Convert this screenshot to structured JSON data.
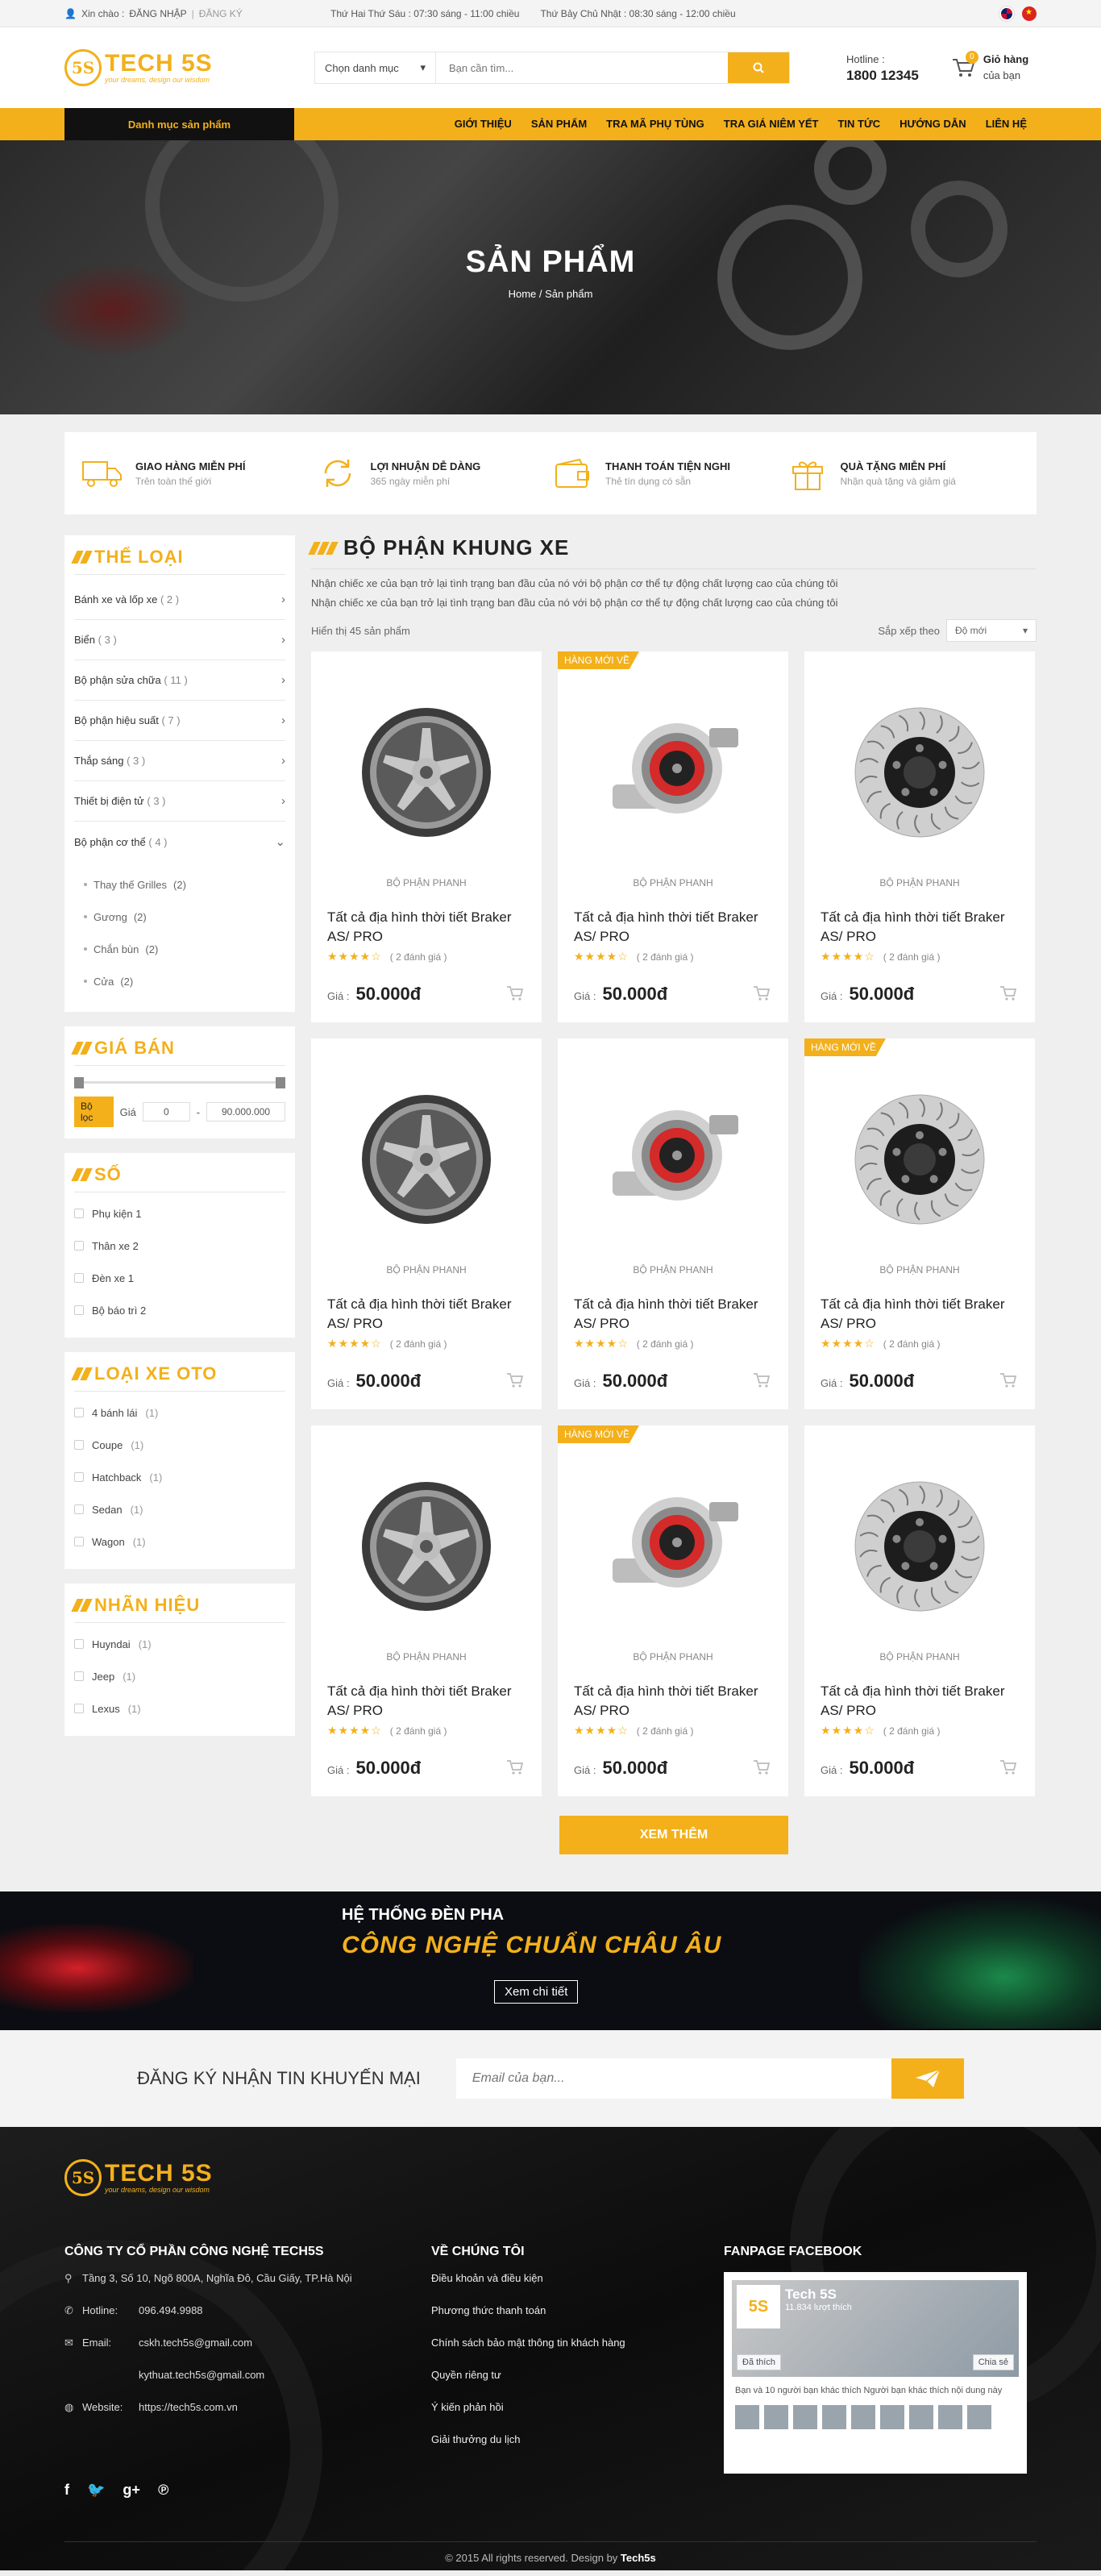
{
  "topbar": {
    "greeting": "Xin chào :",
    "login": "ĐĂNG NHẬP",
    "separator": "|",
    "register": "ĐĂNG KÝ",
    "hours_weekday": "Thứ Hai Thứ Sáu : 07:30 sáng - 11:00 chiều",
    "hours_weekend": "Thứ Bảy Chủ Nhật : 08:30 sáng - 12:00 chiều"
  },
  "header": {
    "logo_text": "TECH 5S",
    "logo_mark": "5S",
    "logo_slogan": "your dreams, design our wisdom",
    "search_category": "Chọn danh mục",
    "search_placeholder": "Bạn cần tìm...",
    "hotline_label": "Hotline :",
    "hotline_number": "1800 12345",
    "cart_count": "0",
    "cart_title": "Giỏ hàng",
    "cart_sub": "của bạn"
  },
  "nav": {
    "categories_label": "Danh mục sản phẩm",
    "items": [
      "GIỚI THIỆU",
      "SẢN PHẨM",
      "TRA MÃ PHỤ TÙNG",
      "TRA GIÁ NIÊM YẾT",
      "TIN TỨC",
      "HƯỚNG DẪN",
      "LIÊN HỆ"
    ]
  },
  "hero": {
    "title": "SẢN PHẨM",
    "breadcrumb_home": "Home",
    "breadcrumb_sep": "/",
    "breadcrumb_current": "Sản phẩm"
  },
  "features": [
    {
      "title": "GIAO HÀNG MIỄN PHÍ",
      "sub": "Trên toàn thế giới",
      "icon": "truck-icon"
    },
    {
      "title": "LỢI NHUẬN DỄ DÀNG",
      "sub": "365 ngày miễn phí",
      "icon": "refresh-icon"
    },
    {
      "title": "THANH TOÁN TIỆN NGHI",
      "sub": "Thẻ tín dụng có sẵn",
      "icon": "wallet-icon"
    },
    {
      "title": "QUÀ TẶNG MIỄN PHÍ",
      "sub": "Nhận quà tặng và giảm giá",
      "icon": "gift-icon"
    }
  ],
  "sidebar": {
    "category_title": "THỂ LOẠI",
    "categories": [
      {
        "label": "Bánh xe và lốp xe",
        "count": "( 2 )"
      },
      {
        "label": "Biển",
        "count": "( 3 )"
      },
      {
        "label": "Bộ phận sửa chữa",
        "count": "( 11 )"
      },
      {
        "label": "Bộ phận hiệu suất",
        "count": "( 7 )"
      },
      {
        "label": "Thắp sáng",
        "count": "( 3 )"
      },
      {
        "label": "Thiết bị điện tử",
        "count": "( 3 )"
      },
      {
        "label": "Bộ phận cơ thể",
        "count": "( 4 )"
      }
    ],
    "subcategories": [
      {
        "label": "Thay thế Grilles",
        "count": "(2)"
      },
      {
        "label": "Gương",
        "count": "(2)"
      },
      {
        "label": "Chắn bùn",
        "count": "(2)"
      },
      {
        "label": "Cửa",
        "count": "(2)"
      }
    ],
    "price_title": "GIÁ BÁN",
    "price_filter": "Bộ lọc",
    "price_label": "Giá",
    "price_min": "0",
    "price_dash": "-",
    "price_max": "90.000.000",
    "so_title": "SỐ",
    "so_items": [
      "Phụ kiện 1",
      "Thân xe 2",
      "Đèn xe 1",
      "Bộ báo trì 2"
    ],
    "car_type_title": "LOẠI XE OTO",
    "car_types": [
      {
        "label": "4 bánh lái",
        "count": "(1)"
      },
      {
        "label": "Coupe",
        "count": "(1)"
      },
      {
        "label": "Hatchback",
        "count": "(1)"
      },
      {
        "label": "Sedan",
        "count": "(1)"
      },
      {
        "label": "Wagon",
        "count": "(1)"
      }
    ],
    "brand_title": "NHÃN HIỆU",
    "brands": [
      {
        "label": "Huyndai",
        "count": "(1)"
      },
      {
        "label": "Jeep",
        "count": "(1)"
      },
      {
        "label": "Lexus",
        "count": "(1)"
      }
    ]
  },
  "content": {
    "title": "BỘ PHẬN KHUNG XE",
    "desc1": "Nhận chiếc xe của bạn trở lại tình trạng ban đầu của nó  với bộ phận cơ thể tự động chất lượng cao của chúng tôi",
    "desc2": "Nhận chiếc xe của bạn trở lại tình trạng ban đầu của nó  với bộ phận cơ thể tự động chất lượng cao của chúng tôi",
    "showing": "Hiển thị 45 sản phẩm",
    "sort_label": "Sắp xếp theo",
    "sort_value": "Độ mới",
    "more_button": "XEM THÊM",
    "products": [
      {
        "ribbon": "",
        "image": "wheel",
        "category": "BỘ PHẬN PHANH",
        "name": "Tất cả địa hình thời tiết Braker AS/ PRO",
        "stars": "★★★★☆",
        "reviews": "( 2 đánh giá )",
        "price_label": "Giá :",
        "price": "50.000đ"
      },
      {
        "ribbon": "HÀNG MỚI VỀ",
        "image": "turbo",
        "category": "BỘ PHẬN PHANH",
        "name": "Tất cả địa hình thời tiết Braker AS/ PRO",
        "stars": "★★★★☆",
        "reviews": "( 2 đánh giá )",
        "price_label": "Giá :",
        "price": "50.000đ"
      },
      {
        "ribbon": "",
        "image": "disc",
        "category": "BỘ PHẬN PHANH",
        "name": "Tất cả địa hình thời tiết Braker AS/ PRO",
        "stars": "★★★★☆",
        "reviews": "( 2 đánh giá )",
        "price_label": "Giá :",
        "price": "50.000đ"
      },
      {
        "ribbon": "",
        "image": "wheel",
        "category": "BỘ PHẬN PHANH",
        "name": "Tất cả địa hình thời tiết Braker AS/ PRO",
        "stars": "★★★★☆",
        "reviews": "( 2 đánh giá )",
        "price_label": "Giá :",
        "price": "50.000đ"
      },
      {
        "ribbon": "",
        "image": "turbo",
        "category": "BỘ PHẬN PHANH",
        "name": "Tất cả địa hình thời tiết Braker AS/ PRO",
        "stars": "★★★★☆",
        "reviews": "( 2 đánh giá )",
        "price_label": "Giá :",
        "price": "50.000đ"
      },
      {
        "ribbon": "HÀNG MỚI VỀ",
        "image": "disc",
        "category": "BỘ PHẬN PHANH",
        "name": "Tất cả địa hình thời tiết Braker AS/ PRO",
        "stars": "★★★★☆",
        "reviews": "( 2 đánh giá )",
        "price_label": "Giá :",
        "price": "50.000đ"
      },
      {
        "ribbon": "",
        "image": "wheel",
        "category": "BỘ PHẬN PHANH",
        "name": "Tất cả địa hình thời tiết Braker AS/ PRO",
        "stars": "★★★★☆",
        "reviews": "( 2 đánh giá )",
        "price_label": "Giá :",
        "price": "50.000đ"
      },
      {
        "ribbon": "HÀNG MỚI VỀ",
        "image": "turbo",
        "category": "BỘ PHẬN PHANH",
        "name": "Tất cả địa hình thời tiết Braker AS/ PRO",
        "stars": "★★★★☆",
        "reviews": "( 2 đánh giá )",
        "price_label": "Giá :",
        "price": "50.000đ"
      },
      {
        "ribbon": "",
        "image": "disc",
        "category": "BỘ PHẬN PHANH",
        "name": "Tất cả địa hình thời tiết Braker AS/ PRO",
        "stars": "★★★★☆",
        "reviews": "( 2 đánh giá )",
        "price_label": "Giá :",
        "price": "50.000đ"
      }
    ]
  },
  "banner": {
    "line1": "HỆ THỐNG ĐÈN PHA",
    "line2": "CÔNG NGHỆ CHUẨN CHÂU ÂU",
    "button": "Xem chi tiết"
  },
  "newsletter": {
    "label": "ĐĂNG KÝ NHẬN TIN KHUYẾN MẠI",
    "placeholder": "Email của bạn..."
  },
  "footer": {
    "company": "CÔNG TY CỔ PHẦN CÔNG NGHỆ TECH5S",
    "address": "Tầng 3, Số 10, Ngõ 800A, Nghĩa Đô, Cầu Giấy, TP.Hà Nội",
    "hotline_label": "Hotline:",
    "hotline": "096.494.9988",
    "email_label": "Email:",
    "email1": "cskh.tech5s@gmail.com",
    "email2": "kythuat.tech5s@gmail.com",
    "website_label": "Website:",
    "website": "https://tech5s.com.vn",
    "about_title": "VỀ CHÚNG TÔI",
    "about_links": [
      "Điều khoản và điều kiện",
      "Phương thức thanh toán",
      "Chính sách bảo mật thông tin khách hàng",
      "Quyền riêng tư",
      "Ý kiến phản hồi",
      "Giải thưởng du lịch"
    ],
    "fanpage_title": "FANPAGE FACEBOOK",
    "fb_name": "Tech 5S",
    "fb_likes": "11.834 lượt thích",
    "fb_like_btn": "Đã thích",
    "fb_share_btn": "Chia sẻ",
    "fb_text": "Bạn và 10 người bạn khác thích Người bạn khác thích nội dung này",
    "copyright": "© 2015 All rights reserved. Design by",
    "copyright_brand": "Tech5s"
  },
  "colors": {
    "accent": "#f3b01b",
    "dark": "#111111"
  }
}
